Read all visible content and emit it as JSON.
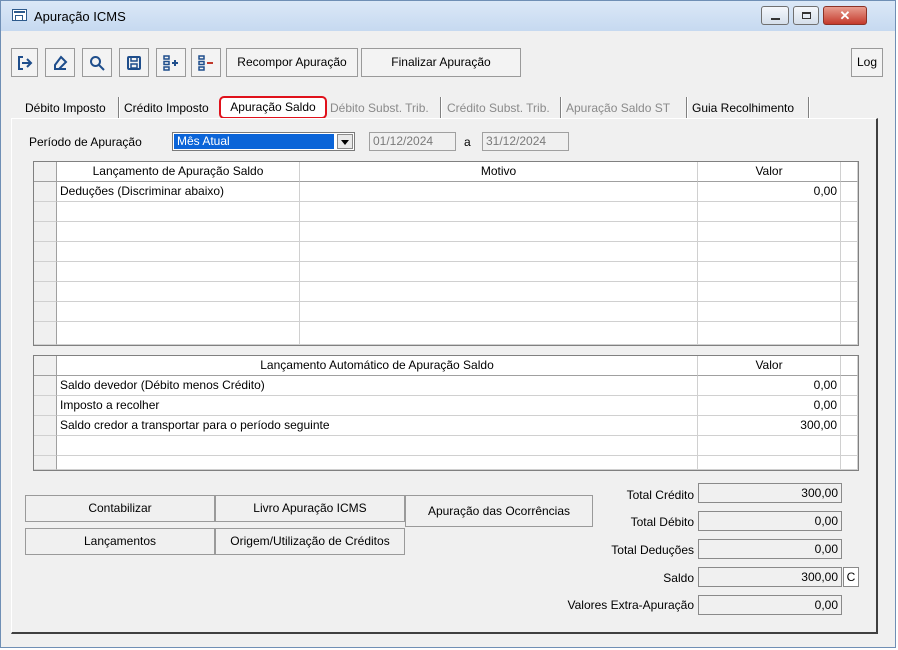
{
  "window": {
    "title": "Apuração ICMS"
  },
  "toolbar": {
    "icons": [
      "exit-icon",
      "eraser-icon",
      "search-icon",
      "save-icon",
      "add-row-icon",
      "remove-row-icon"
    ],
    "recompor_label": "Recompor Apuração",
    "finalizar_label": "Finalizar Apuração",
    "log_label": "Log"
  },
  "tabs": [
    {
      "label": "Débito Imposto",
      "enabled": true
    },
    {
      "label": "Crédito Imposto",
      "enabled": true
    },
    {
      "label": "Apuração Saldo",
      "enabled": true,
      "active": true
    },
    {
      "label": "Débito Subst. Trib.",
      "enabled": false
    },
    {
      "label": "Crédito Subst. Trib.",
      "enabled": false
    },
    {
      "label": "Apuração Saldo ST",
      "enabled": false
    },
    {
      "label": "Guia Recolhimento",
      "enabled": true
    }
  ],
  "periodo": {
    "label": "Período de  Apuração",
    "selected": "Mês Atual",
    "start": "01/12/2024",
    "sep": "a",
    "end": "31/12/2024"
  },
  "grid1": {
    "headers": [
      "Lançamento de Apuração Saldo",
      "Motivo",
      "Valor"
    ],
    "rows": [
      {
        "lancamento": "Deduções (Discriminar abaixo)",
        "motivo": "",
        "valor": "0,00"
      }
    ]
  },
  "grid2": {
    "headers": [
      "Lançamento Automático de Apuração Saldo",
      "Valor"
    ],
    "rows": [
      {
        "lancamento": "Saldo devedor (Débito menos Crédito)",
        "valor": "0,00"
      },
      {
        "lancamento": "Imposto a recolher",
        "valor": "0,00"
      },
      {
        "lancamento": "Saldo credor a transportar para o período seguinte",
        "valor": "300,00"
      }
    ]
  },
  "actions": {
    "contabilizar": "Contabilizar",
    "livro": "Livro Apuração ICMS",
    "ocorrencias": "Apuração das Ocorrências",
    "lancamentos": "Lançamentos",
    "origem": "Origem/Utilização de Créditos"
  },
  "totals": {
    "credito_label": "Total Crédito",
    "credito": "300,00",
    "debito_label": "Total Débito",
    "debito": "0,00",
    "deducoes_label": "Total Deduções",
    "deducoes": "0,00",
    "saldo_label": "Saldo",
    "saldo": "300,00",
    "saldo_indicator": "C",
    "extra_label": "Valores Extra-Apuração",
    "extra": "0,00"
  }
}
